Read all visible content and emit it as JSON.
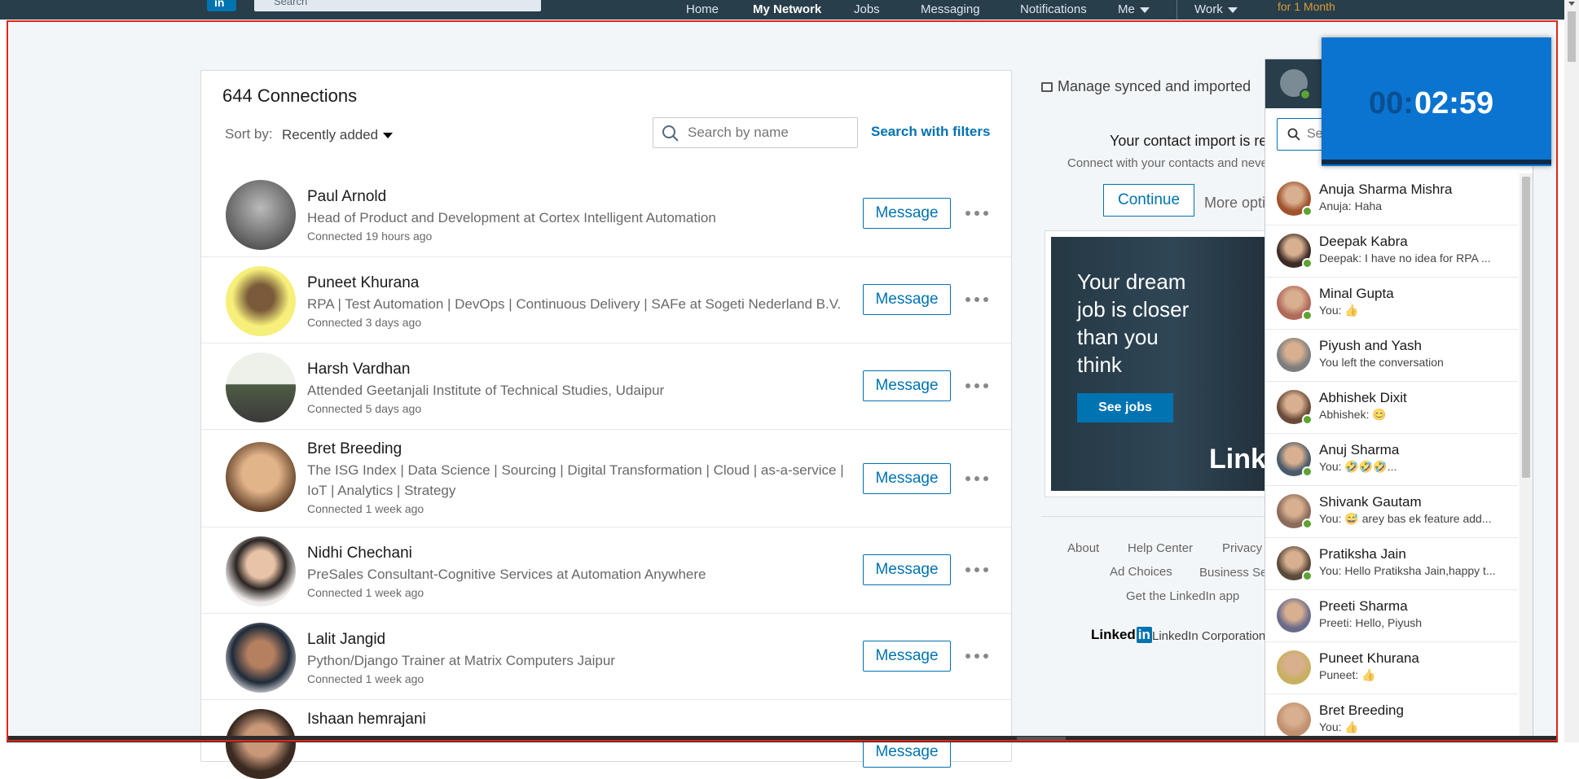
{
  "topnav": {
    "logo": "in",
    "search_placeholder": "Search",
    "items": {
      "home": "Home",
      "my_network": "My Network",
      "jobs": "Jobs",
      "messaging": "Messaging",
      "notifications": "Notifications",
      "me": "Me",
      "work": "Work"
    },
    "promo": "for 1 Month"
  },
  "connections": {
    "title": "644 Connections",
    "sort_label": "Sort by:",
    "sort_value": "Recently added",
    "search_placeholder": "Search by name",
    "search_filters": "Search with filters",
    "message_label": "Message",
    "list": [
      {
        "name": "Paul Arnold",
        "headline": "Head of Product and Development at Cortex Intelligent Automation",
        "time": "Connected 19 hours ago"
      },
      {
        "name": "Puneet Khurana",
        "headline": "RPA | Test Automation | DevOps | Continuous Delivery | SAFe at Sogeti Nederland B.V.",
        "time": "Connected 3 days ago"
      },
      {
        "name": "Harsh Vardhan",
        "headline": "Attended Geetanjali Institute of Technical Studies, Udaipur",
        "time": "Connected 5 days ago"
      },
      {
        "name": "Bret Breeding",
        "headline": "The ISG Index | Data Science | Sourcing | Digital Transformation | Cloud | as-a-service | IoT | Analytics | Strategy",
        "time": "Connected 1 week ago"
      },
      {
        "name": "Nidhi Chechani",
        "headline": "PreSales Consultant-Cognitive Services at Automation Anywhere",
        "time": "Connected 1 week ago"
      },
      {
        "name": "Lalit Jangid",
        "headline": "Python/Django Trainer at Matrix Computers Jaipur",
        "time": "Connected 1 week ago"
      },
      {
        "name": "Ishaan hemrajani",
        "headline": "",
        "time": ""
      }
    ]
  },
  "sidebar": {
    "manage": "Manage synced and imported",
    "import_text": "Your contact import is re",
    "connect_text": "Connect with your contacts and neve",
    "continue_label": "Continue",
    "more_options": "More opti",
    "ad": {
      "headline": "Your dream job is closer than you think",
      "button": "See jobs",
      "brand": "Linke"
    },
    "footer": {
      "about": "About",
      "help": "Help Center",
      "privacy": "Privacy",
      "ad_choices": "Ad Choices",
      "business": "Business Ser",
      "get_app": "Get the LinkedIn app",
      "brand_linked": "Linked",
      "brand_in": "in",
      "corp": "LinkedIn Corporation"
    }
  },
  "messaging": {
    "search_placeholder": "Se",
    "items": [
      {
        "name": "Anuja Sharma Mishra",
        "preview": "Anuja: Haha",
        "online": true
      },
      {
        "name": "Deepak Kabra",
        "preview": "Deepak: I have no idea for RPA ...",
        "online": true
      },
      {
        "name": "Minal Gupta",
        "preview": "You: 👍",
        "online": true
      },
      {
        "name": "Piyush and Yash",
        "preview": "You left the conversation",
        "online": false
      },
      {
        "name": "Abhishek Dixit",
        "preview": "Abhishek: 😊",
        "online": true
      },
      {
        "name": "Anuj Sharma",
        "preview": "You: 🤣🤣🤣...",
        "online": true
      },
      {
        "name": "Shivank Gautam",
        "preview": "You: 😅 arey bas ek feature add...",
        "online": true
      },
      {
        "name": "Pratiksha Jain",
        "preview": "You: Hello Pratiksha Jain,happy t...",
        "online": true
      },
      {
        "name": "Preeti Sharma",
        "preview": "Preeti: Hello, Piyush",
        "online": false
      },
      {
        "name": "Puneet Khurana",
        "preview": "Puneet: 👍",
        "online": false
      },
      {
        "name": "Bret Breeding",
        "preview": "You: 👍",
        "online": false
      }
    ]
  },
  "timer": {
    "dim": "00:",
    "value": "02:59"
  },
  "colors": {
    "brand": "#0073b1",
    "navbar": "#283e4a",
    "page_bg": "#f3f6f8",
    "frame_border": "#e2231a",
    "online": "#5ca332"
  }
}
